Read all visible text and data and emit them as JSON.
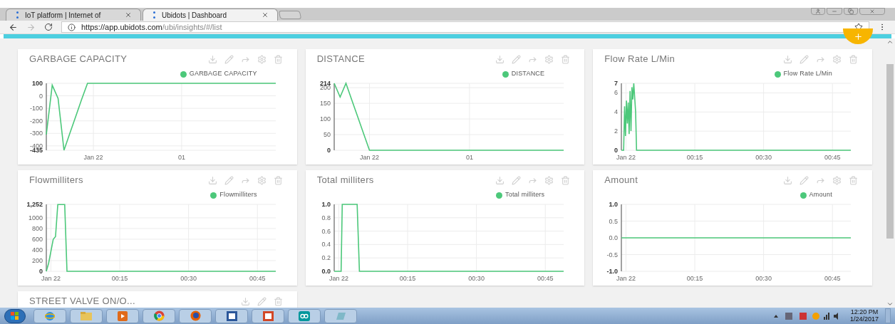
{
  "browser": {
    "tabs": [
      {
        "label": "IoT platform | Internet of",
        "selected": false
      },
      {
        "label": "Ubidots | Dashboard",
        "selected": true
      }
    ],
    "url_host": "https://app.ubidots.com",
    "url_path": "/ubi/insights/#/list"
  },
  "cards": [
    {
      "kind": "chart",
      "title": "GARBAGE CAPACITY",
      "chart_data": {
        "type": "line",
        "ylim": [
          -435,
          100
        ],
        "yticks": [
          -435,
          -400,
          -300,
          -200,
          -100,
          0,
          100
        ],
        "grid": true,
        "categories": [
          null,
          null,
          null,
          null,
          null,
          null,
          null,
          null,
          "Jan 22",
          null,
          null,
          null,
          null,
          null,
          null,
          null,
          null,
          null,
          null,
          null,
          null,
          null,
          null,
          "01",
          null,
          null,
          null,
          null,
          null,
          null,
          null,
          null,
          null,
          null,
          null,
          null,
          null,
          null,
          null,
          null
        ],
        "series": [
          {
            "name": "GARBAGE CAPACITY",
            "color": "#4cc87a",
            "values": [
              -310,
              85,
              -20,
              -435,
              -300,
              -165,
              -30,
              100,
              100,
              100,
              100,
              100,
              100,
              100,
              100,
              100,
              100,
              100,
              100,
              100,
              100,
              100,
              100,
              100,
              100,
              100,
              100,
              100,
              100,
              100,
              100,
              100,
              100,
              100,
              100,
              100,
              100,
              100,
              100,
              100
            ]
          }
        ]
      }
    },
    {
      "kind": "chart",
      "title": "DISTANCE",
      "chart_data": {
        "type": "line",
        "ylim": [
          0,
          214
        ],
        "yticks": [
          0,
          50,
          100,
          150,
          200,
          214
        ],
        "grid": true,
        "categories": [
          null,
          null,
          null,
          null,
          null,
          null,
          "Jan 22",
          null,
          null,
          null,
          null,
          null,
          null,
          null,
          null,
          null,
          null,
          null,
          null,
          null,
          null,
          null,
          null,
          "01",
          null,
          null,
          null,
          null,
          null,
          null,
          null,
          null,
          null,
          null,
          null,
          null,
          null,
          null,
          null,
          null
        ],
        "series": [
          {
            "name": "DISTANCE",
            "color": "#4cc87a",
            "values": [
              214,
              170,
              214,
              160,
              107,
              53,
              0,
              0,
              0,
              0,
              0,
              0,
              0,
              0,
              0,
              0,
              0,
              0,
              0,
              0,
              0,
              0,
              0,
              0,
              0,
              0,
              0,
              0,
              0,
              0,
              0,
              0,
              0,
              0,
              0,
              0,
              0,
              0,
              0,
              0
            ]
          }
        ]
      }
    },
    {
      "kind": "chart",
      "title": "Flow Rate L/Min",
      "chart_data": {
        "type": "line",
        "grid": true,
        "xlim": [
          -1,
          49
        ],
        "ylim": [
          0,
          7
        ],
        "yticks": [
          0,
          2,
          4,
          6,
          7
        ],
        "xticks": [
          {
            "value": 0,
            "label": "Jan 22"
          },
          {
            "value": 15,
            "label": "00:15"
          },
          {
            "value": 30,
            "label": "00:30"
          },
          {
            "value": 45,
            "label": "00:45"
          }
        ],
        "x": [
          -1,
          -0.5,
          -0.3,
          -0.1,
          0.1,
          0.3,
          0.5,
          0.7,
          0.9,
          1.1,
          1.3,
          1.5,
          1.7,
          1.9,
          2.1,
          2.3,
          49
        ],
        "series": [
          {
            "name": "Flow Rate L/Min",
            "color": "#4cc87a",
            "values": [
              0,
              0,
              4.6,
              1.5,
              5.2,
              2.8,
              5,
              1.7,
              6.2,
              2,
              6.6,
              5.3,
              7,
              5.5,
              4,
              0,
              0
            ]
          }
        ]
      }
    },
    {
      "kind": "chart",
      "title": "Flowmilliters",
      "chart_data": {
        "type": "line",
        "grid": true,
        "xlim": [
          -1,
          49
        ],
        "ylim": [
          0,
          1252
        ],
        "yticks": [
          0,
          200,
          400,
          600,
          800,
          1000,
          {
            "value": 1252,
            "label": "1,252"
          }
        ],
        "xticks": [
          {
            "value": 0,
            "label": "Jan 22"
          },
          {
            "value": 15,
            "label": "00:15"
          },
          {
            "value": 30,
            "label": "00:30"
          },
          {
            "value": 45,
            "label": "00:45"
          }
        ],
        "x": [
          -1,
          -0.5,
          0.5,
          1,
          1.5,
          3,
          3.5,
          49
        ],
        "series": [
          {
            "name": "Flowmilliters",
            "color": "#4cc87a",
            "values": [
              0,
              150,
              600,
              650,
              1250,
              1250,
              0,
              0
            ]
          }
        ]
      }
    },
    {
      "kind": "chart",
      "title": "Total milliters",
      "chart_data": {
        "type": "line",
        "grid": true,
        "xlim": [
          -1,
          49
        ],
        "ylim": [
          0,
          1
        ],
        "yticks": [
          {
            "value": 0,
            "label": "0.0"
          },
          {
            "value": 0.2,
            "label": "0.2"
          },
          {
            "value": 0.4,
            "label": "0.4"
          },
          {
            "value": 0.6,
            "label": "0.6"
          },
          {
            "value": 0.8,
            "label": "0.8"
          },
          {
            "value": 1,
            "label": "1.0"
          }
        ],
        "xticks": [
          {
            "value": 0,
            "label": "Jan 22"
          },
          {
            "value": 15,
            "label": "00:15"
          },
          {
            "value": 30,
            "label": "00:30"
          },
          {
            "value": 45,
            "label": "00:45"
          }
        ],
        "x": [
          -1,
          0.5,
          0.75,
          4,
          4.5,
          49
        ],
        "series": [
          {
            "name": "Total milliters",
            "color": "#4cc87a",
            "values": [
              0,
              0,
              1,
              1,
              0,
              0
            ]
          }
        ]
      }
    },
    {
      "kind": "chart",
      "title": "Amount",
      "chart_data": {
        "type": "line",
        "grid": true,
        "xlim": [
          -1,
          49
        ],
        "ylim": [
          -1,
          1
        ],
        "yticks": [
          {
            "value": -1,
            "label": "-1.0"
          },
          {
            "value": -0.5,
            "label": "-0.5"
          },
          {
            "value": 0,
            "label": "0.0"
          },
          {
            "value": 0.5,
            "label": "0.5"
          },
          {
            "value": 1,
            "label": "1.0"
          }
        ],
        "xticks": [
          {
            "value": 0,
            "label": "Jan 22"
          },
          {
            "value": 15,
            "label": "00:15"
          },
          {
            "value": 30,
            "label": "00:30"
          },
          {
            "value": 45,
            "label": "00:45"
          }
        ],
        "x": [
          -1,
          49
        ],
        "series": [
          {
            "name": "Amount",
            "color": "#4cc87a",
            "values": [
              0,
              0
            ]
          }
        ]
      }
    },
    {
      "kind": "indicator",
      "title": "STREET VALVE ON/O..."
    }
  ],
  "taskbar": {
    "time": "12:20 PM",
    "date": "1/24/2017"
  }
}
